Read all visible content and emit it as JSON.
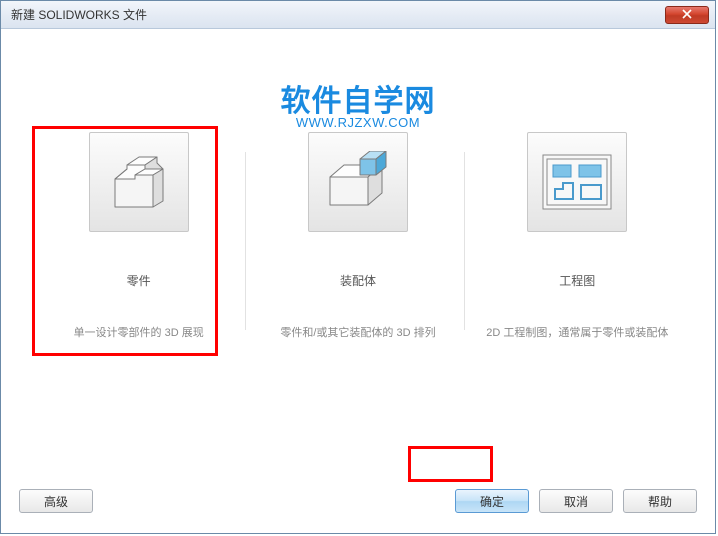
{
  "titlebar": {
    "title": "新建 SOLIDWORKS 文件"
  },
  "watermark": {
    "main": "软件自学网",
    "sub": "WWW.RJZXW.COM"
  },
  "options": {
    "part": {
      "title": "零件",
      "desc": "单一设计零部件的 3D 展现"
    },
    "assembly": {
      "title": "装配体",
      "desc": "零件和/或其它装配体的 3D 排列"
    },
    "drawing": {
      "title": "工程图",
      "desc": "2D 工程制图，通常属于零件或装配体"
    }
  },
  "buttons": {
    "advanced": "高级",
    "ok": "确定",
    "cancel": "取消",
    "help": "帮助"
  }
}
